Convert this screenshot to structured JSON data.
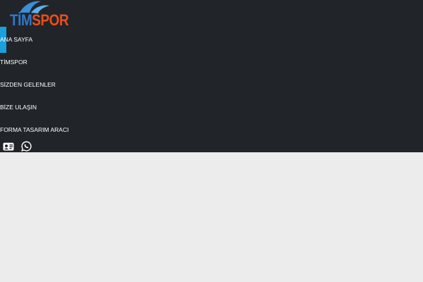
{
  "brand": {
    "part1": "TİM",
    "part2": "SPOR",
    "colors": {
      "tim": "#2f78c8",
      "spor": "#e94e1b",
      "swoosh": "#3a8fd6"
    }
  },
  "nav": {
    "active_index": 0,
    "active_color": "#1aa0dc",
    "items": [
      {
        "label": "ANA SAYFA"
      },
      {
        "label": "TİMSPOR"
      },
      {
        "label": "SİZDEN GELENLER"
      },
      {
        "label": "BİZE ULAŞIN"
      },
      {
        "label": "FORMA TASARIM ARACI"
      }
    ]
  },
  "social": {
    "icons": [
      "id-card-icon",
      "whatsapp-icon"
    ]
  },
  "theme": {
    "header_bg": "#212529",
    "page_bg": "#ececec",
    "text": "#ffffff"
  }
}
